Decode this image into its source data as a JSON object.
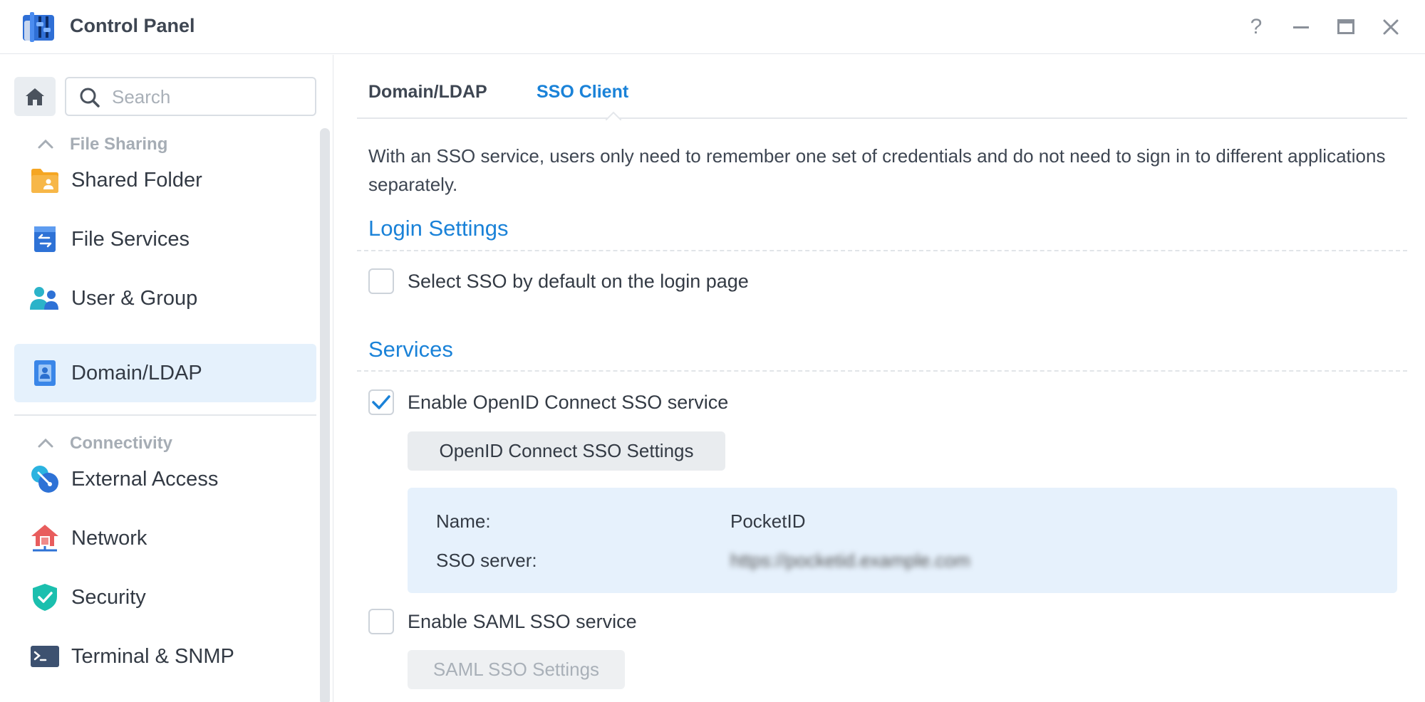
{
  "window": {
    "title": "Control Panel",
    "help_glyph": "?",
    "minimize_glyph": "—",
    "maximize_glyph": "▭",
    "close_glyph": "✕"
  },
  "sidebar": {
    "search_placeholder": "Search",
    "groups": [
      {
        "label": "File Sharing",
        "items": [
          {
            "label": "Shared Folder",
            "icon": "shared-folder-icon"
          },
          {
            "label": "File Services",
            "icon": "file-services-icon"
          },
          {
            "label": "User & Group",
            "icon": "user-group-icon"
          },
          {
            "label": "Domain/LDAP",
            "icon": "domain-ldap-icon",
            "active": true
          }
        ]
      },
      {
        "label": "Connectivity",
        "items": [
          {
            "label": "External Access",
            "icon": "external-access-icon"
          },
          {
            "label": "Network",
            "icon": "network-icon"
          },
          {
            "label": "Security",
            "icon": "security-icon"
          },
          {
            "label": "Terminal & SNMP",
            "icon": "terminal-icon"
          }
        ]
      }
    ]
  },
  "tabs": [
    {
      "label": "Domain/LDAP",
      "active": false
    },
    {
      "label": "SSO Client",
      "active": true
    }
  ],
  "content": {
    "intro": "With an SSO service, users only need to remember one set of credentials and do not need to sign in to different applications separately.",
    "login_settings": {
      "title": "Login Settings",
      "select_sso_default": {
        "label": "Select SSO by default on the login page",
        "checked": false
      }
    },
    "services": {
      "title": "Services",
      "openid": {
        "label": "Enable OpenID Connect SSO service",
        "checked": true,
        "settings_button": "OpenID Connect SSO Settings",
        "name_key": "Name:",
        "name_value": "PocketID",
        "server_key": "SSO server:",
        "server_value": "https://pocketid.example.com"
      },
      "saml": {
        "label": "Enable SAML SSO service",
        "checked": false,
        "settings_button": "SAML SSO Settings"
      }
    }
  },
  "colors": {
    "accent": "#1a82d8",
    "active_nav_bg": "#e5f1fc",
    "info_box_bg": "#e6f1fc"
  }
}
